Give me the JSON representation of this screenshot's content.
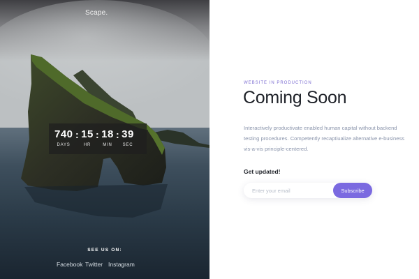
{
  "brand": {
    "name": "Scape."
  },
  "countdown": {
    "days": "740",
    "days_label": "DAYS",
    "hours": "15",
    "hours_label": "HR",
    "minutes": "18",
    "minutes_label": "MIN",
    "seconds": "39",
    "seconds_label": "SEC",
    "separator": ":"
  },
  "social": {
    "heading": "SEE US ON:",
    "links": [
      "Facebook",
      "Twitter",
      "Instagram"
    ]
  },
  "content": {
    "eyebrow": "WEBSITE IN PRODUCTION",
    "title": "Coming Soon",
    "description": "Interactively productivate enabled human capital without backend testing procedures. Competently recaptiualize alternative e-business vis-a-vis principle-centered.",
    "updates_label": "Get updated!",
    "email_placeholder": "Enter your email",
    "subscribe_label": "Subscribe"
  },
  "colors": {
    "accent": "#7b6ae0",
    "eyebrow": "#7a6bd1",
    "heading": "#1e2128",
    "body_text": "#8a94ab"
  }
}
